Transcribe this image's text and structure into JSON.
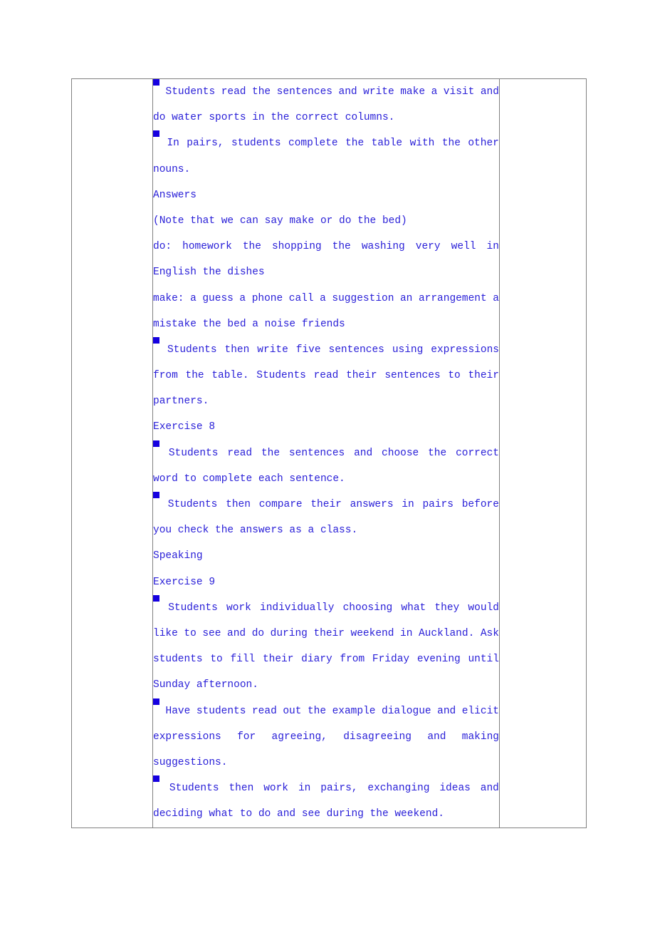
{
  "document": {
    "text_color": "#2A20D8",
    "bullet_color": "#1500E0",
    "border_color": "#808080",
    "bullet_icon": "filled-square-bullet"
  },
  "table": {
    "columns": [
      "left-margin-column",
      "main-content-column",
      "right-margin-column"
    ],
    "left_cell_text": "",
    "right_cell_text": ""
  },
  "content": {
    "lines": [
      {
        "id": "l01",
        "bullet": true,
        "justify": true,
        "words": [
          "Students",
          "read",
          "the",
          "sentences",
          "and",
          "write",
          "make",
          "a",
          "visit",
          "and"
        ]
      },
      {
        "id": "l02",
        "bullet": false,
        "justify": false,
        "words": [
          "do water sports in the correct columns."
        ]
      },
      {
        "id": "l03",
        "bullet": true,
        "justify": true,
        "words": [
          "In",
          "pairs,",
          "students",
          "complete",
          "the",
          "table",
          "with",
          "the",
          "other"
        ]
      },
      {
        "id": "l04",
        "bullet": false,
        "justify": false,
        "words": [
          "nouns."
        ]
      },
      {
        "id": "l05",
        "bullet": false,
        "justify": false,
        "words": [
          "Answers"
        ]
      },
      {
        "id": "l06",
        "bullet": false,
        "justify": false,
        "words": [
          "(Note that we can say make or do the bed)"
        ]
      },
      {
        "id": "l07",
        "bullet": false,
        "justify": true,
        "words": [
          "do:",
          "homework",
          "the",
          "shopping",
          "the",
          "washing",
          "very",
          "well",
          "in"
        ]
      },
      {
        "id": "l08",
        "bullet": false,
        "justify": false,
        "words": [
          "English the dishes"
        ]
      },
      {
        "id": "l09",
        "bullet": false,
        "justify": true,
        "words": [
          "make:",
          "a",
          "guess",
          "a",
          "phone",
          "call",
          "a",
          "suggestion",
          "an",
          "arrangement",
          "a"
        ]
      },
      {
        "id": "l10",
        "bullet": false,
        "justify": false,
        "words": [
          "mistake the bed a noise friends"
        ]
      },
      {
        "id": "l11",
        "bullet": true,
        "justify": true,
        "words": [
          "Students",
          "then",
          "write",
          "five",
          "sentences",
          "using",
          "expressions"
        ]
      },
      {
        "id": "l12",
        "bullet": false,
        "justify": true,
        "words": [
          "from",
          "the",
          "table.",
          "Students",
          "read",
          "their",
          "sentences",
          "to",
          "their"
        ]
      },
      {
        "id": "l13",
        "bullet": false,
        "justify": false,
        "words": [
          "partners."
        ]
      },
      {
        "id": "l14",
        "bullet": false,
        "justify": false,
        "words": [
          "Exercise 8"
        ]
      },
      {
        "id": "l15",
        "bullet": true,
        "justify": true,
        "words": [
          "Students",
          "read",
          "the",
          "sentences",
          "and",
          "choose",
          "the",
          "correct"
        ]
      },
      {
        "id": "l16",
        "bullet": false,
        "justify": false,
        "words": [
          "word to complete each sentence."
        ]
      },
      {
        "id": "l17",
        "bullet": true,
        "justify": true,
        "words": [
          "Students",
          "then",
          "compare",
          "their",
          "answers",
          "in",
          "pairs",
          "before"
        ]
      },
      {
        "id": "l18",
        "bullet": false,
        "justify": false,
        "words": [
          "you check the answers as a class."
        ]
      },
      {
        "id": "l19",
        "bullet": false,
        "justify": false,
        "words": [
          "Speaking"
        ]
      },
      {
        "id": "l20",
        "bullet": false,
        "justify": false,
        "words": [
          "Exercise 9"
        ]
      },
      {
        "id": "l21",
        "bullet": true,
        "justify": true,
        "words": [
          "Students",
          "work",
          "individually",
          "choosing",
          "what",
          "they",
          "would"
        ]
      },
      {
        "id": "l22",
        "bullet": false,
        "justify": true,
        "words": [
          "like",
          "to",
          "see",
          "and",
          "do",
          "during",
          "their",
          "weekend",
          "in",
          "Auckland.",
          "Ask"
        ]
      },
      {
        "id": "l23",
        "bullet": false,
        "justify": true,
        "words": [
          "students",
          "to",
          "fill",
          "their",
          "diary",
          "from",
          "Friday",
          "evening",
          "until"
        ]
      },
      {
        "id": "l24",
        "bullet": false,
        "justify": false,
        "words": [
          "Sunday afternoon."
        ]
      },
      {
        "id": "l25",
        "bullet": true,
        "justify": true,
        "words": [
          "Have",
          "students",
          "read",
          "out",
          "the",
          "example",
          "dialogue",
          "and",
          "elicit"
        ]
      },
      {
        "id": "l26",
        "bullet": false,
        "justify": true,
        "words": [
          "expressions",
          "for",
          "agreeing,",
          "disagreeing",
          "and",
          "making"
        ]
      },
      {
        "id": "l27",
        "bullet": false,
        "justify": false,
        "words": [
          "suggestions."
        ]
      },
      {
        "id": "l28",
        "bullet": true,
        "justify": true,
        "words": [
          "Students",
          "then",
          "work",
          "in",
          "pairs,",
          "exchanging",
          "ideas",
          "and"
        ]
      },
      {
        "id": "l29",
        "bullet": false,
        "justify": false,
        "words": [
          "deciding what to do and see during the weekend."
        ]
      }
    ]
  }
}
